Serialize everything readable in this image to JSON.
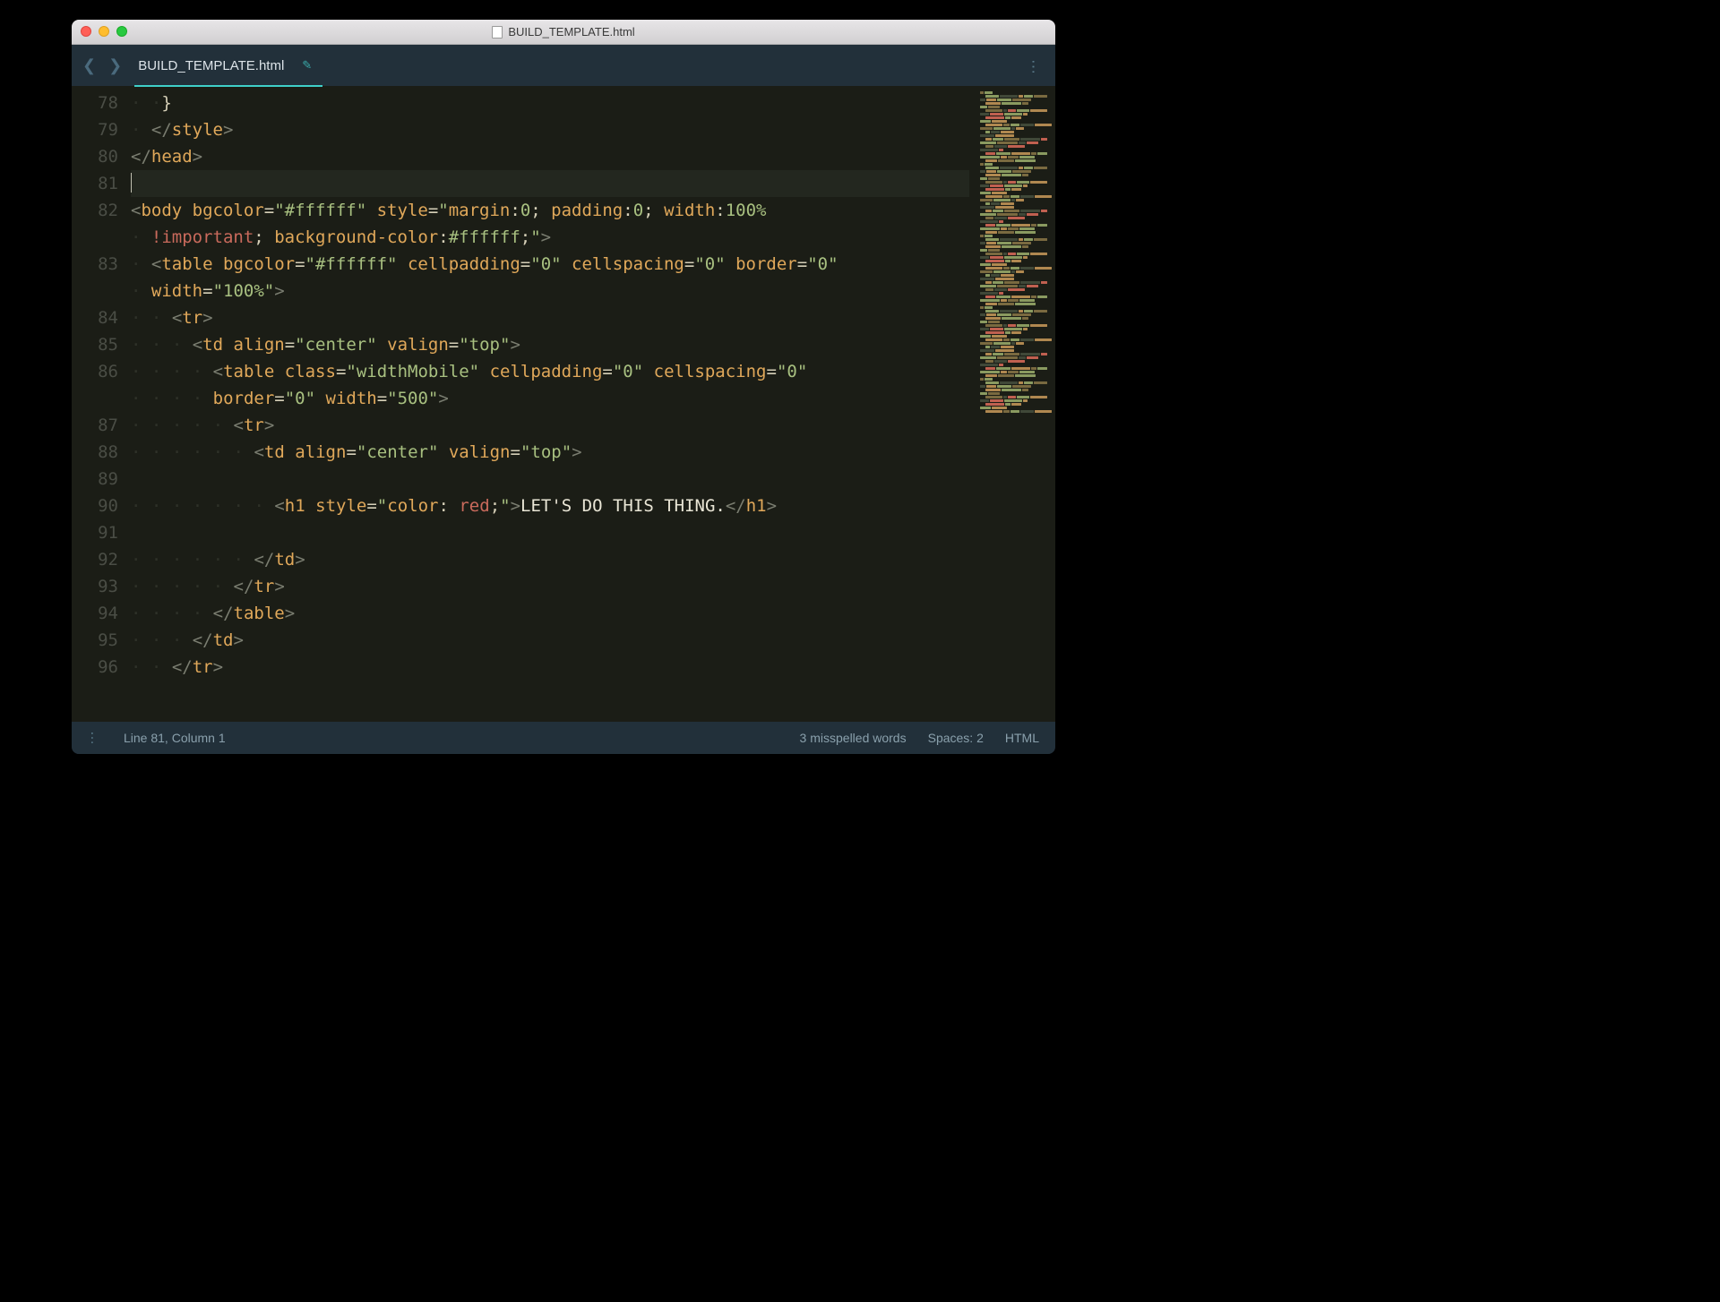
{
  "window": {
    "title": "BUILD_TEMPLATE.html"
  },
  "tab": {
    "filename": "BUILD_TEMPLATE.html",
    "modified": true
  },
  "gutter": {
    "start": 78,
    "end": 96
  },
  "code_lines": [
    {
      "n": 78,
      "indent": 3,
      "html": "<span class='punct'>}</span>"
    },
    {
      "n": 79,
      "indent": 2,
      "html": "<span class='tagb'>&lt;/</span><span class='tag'>style</span><span class='tagb'>&gt;</span>"
    },
    {
      "n": 80,
      "indent": 0,
      "html": "<span class='tagb'>&lt;/</span><span class='tag'>head</span><span class='tagb'>&gt;</span>"
    },
    {
      "n": 81,
      "indent": 0,
      "html": "<span class='cursor'></span>",
      "cursor": true
    },
    {
      "n": 82,
      "indent": 0,
      "html": "<span class='tagb'>&lt;</span><span class='tag'>body</span> <span class='attr'>bgcolor</span><span class='eq'>=</span><span class='str'>\"#ffffff\"</span> <span class='attr'>style</span><span class='eq'>=</span><span class='str'>\"</span><span class='prop'>margin</span><span class='punct'>:</span><span class='str'>0</span><span class='punct'>;</span> <span class='prop'>padding</span><span class='punct'>:</span><span class='str'>0</span><span class='punct'>;</span> <span class='prop'>width</span><span class='punct'>:</span><span class='str'>100%</span>"
    },
    {
      "n": 82,
      "wrap": true,
      "indent": 2,
      "html": "<span class='kw'>!important</span><span class='punct'>;</span> <span class='prop'>background-color</span><span class='punct'>:</span><span class='str'>#ffffff</span><span class='punct'>;</span><span class='str'>\"</span><span class='tagb'>&gt;</span>"
    },
    {
      "n": 83,
      "indent": 2,
      "html": "<span class='tagb'>&lt;</span><span class='tag'>table</span> <span class='attr'>bgcolor</span><span class='eq'>=</span><span class='str'>\"#ffffff\"</span> <span class='attr'>cellpadding</span><span class='eq'>=</span><span class='str'>\"0\"</span> <span class='attr'>cellspacing</span><span class='eq'>=</span><span class='str'>\"0\"</span> <span class='attr'>border</span><span class='eq'>=</span><span class='str'>\"0\"</span>"
    },
    {
      "n": 83,
      "wrap": true,
      "indent": 2,
      "html": "<span class='attr'>width</span><span class='eq'>=</span><span class='str'>\"100%\"</span><span class='tagb'>&gt;</span>"
    },
    {
      "n": 84,
      "indent": 4,
      "html": "<span class='tagb'>&lt;</span><span class='tag'>tr</span><span class='tagb'>&gt;</span>"
    },
    {
      "n": 85,
      "indent": 6,
      "html": "<span class='tagb'>&lt;</span><span class='tag'>td</span> <span class='attr'>align</span><span class='eq'>=</span><span class='str'>\"center\"</span> <span class='attr'>valign</span><span class='eq'>=</span><span class='str'>\"top\"</span><span class='tagb'>&gt;</span>"
    },
    {
      "n": 86,
      "indent": 8,
      "html": "<span class='tagb'>&lt;</span><span class='tag'>table</span> <span class='attr'>class</span><span class='eq'>=</span><span class='str'>\"widthMobile\"</span> <span class='attr'>cellpadding</span><span class='eq'>=</span><span class='str'>\"0\"</span> <span class='attr'>cellspacing</span><span class='eq'>=</span><span class='str'>\"0\"</span>"
    },
    {
      "n": 86,
      "wrap": true,
      "indent": 8,
      "html": "<span class='attr'>border</span><span class='eq'>=</span><span class='str'>\"0\"</span> <span class='attr'>width</span><span class='eq'>=</span><span class='str'>\"500\"</span><span class='tagb'>&gt;</span>"
    },
    {
      "n": 87,
      "indent": 10,
      "html": "<span class='tagb'>&lt;</span><span class='tag'>tr</span><span class='tagb'>&gt;</span>"
    },
    {
      "n": 88,
      "indent": 12,
      "html": "<span class='tagb'>&lt;</span><span class='tag'>td</span> <span class='attr'>align</span><span class='eq'>=</span><span class='str'>\"center\"</span> <span class='attr'>valign</span><span class='eq'>=</span><span class='str'>\"top\"</span><span class='tagb'>&gt;</span>"
    },
    {
      "n": 89,
      "indent": 0,
      "html": ""
    },
    {
      "n": 90,
      "indent": 14,
      "html": "<span class='tagb'>&lt;</span><span class='tag'>h1</span> <span class='attr'>style</span><span class='eq'>=</span><span class='str'>\"</span><span class='prop'>color</span><span class='punct'>:</span> <span class='val'>red</span><span class='punct'>;</span><span class='str'>\"</span><span class='tagb'>&gt;</span><span class='text'>LET'S DO THIS THING.</span><span class='tagb'>&lt;/</span><span class='tag'>h1</span><span class='tagb'>&gt;</span>"
    },
    {
      "n": 91,
      "indent": 0,
      "html": ""
    },
    {
      "n": 92,
      "indent": 12,
      "html": "<span class='tagb'>&lt;/</span><span class='tag'>td</span><span class='tagb'>&gt;</span>"
    },
    {
      "n": 93,
      "indent": 10,
      "html": "<span class='tagb'>&lt;/</span><span class='tag'>tr</span><span class='tagb'>&gt;</span>"
    },
    {
      "n": 94,
      "indent": 8,
      "html": "<span class='tagb'>&lt;/</span><span class='tag'>table</span><span class='tagb'>&gt;</span>"
    },
    {
      "n": 95,
      "indent": 6,
      "html": "<span class='tagb'>&lt;/</span><span class='tag'>td</span><span class='tagb'>&gt;</span>"
    },
    {
      "n": 96,
      "indent": 4,
      "html": "<span class='tagb'>&lt;/</span><span class='tag'>tr</span><span class='tagb'>&gt;</span>"
    }
  ],
  "status": {
    "position": "Line 81, Column 1",
    "spell": "3 misspelled words",
    "spaces": "Spaces: 2",
    "lang": "HTML"
  }
}
